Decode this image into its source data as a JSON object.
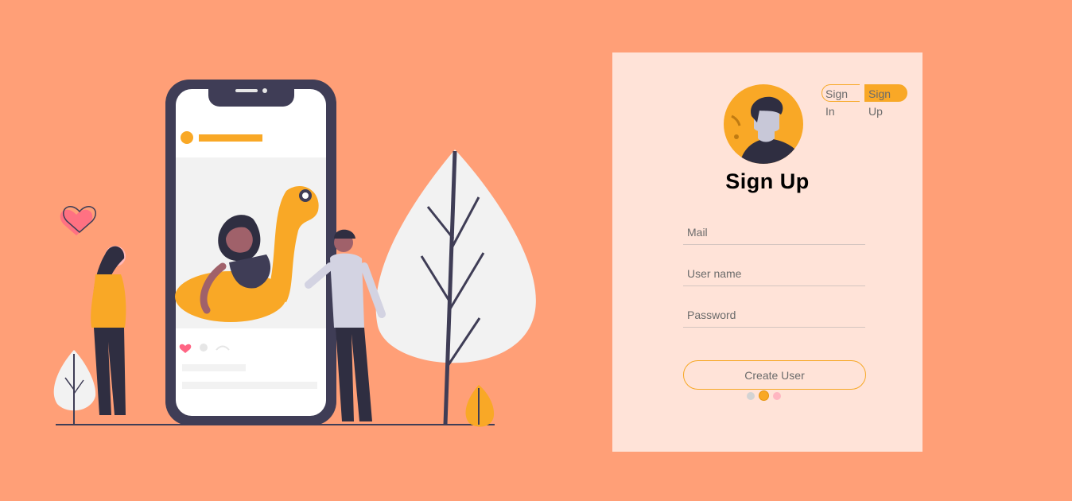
{
  "auth": {
    "sign_in_label": "Sign In",
    "sign_up_label": "Sign Up",
    "title": "Sign Up",
    "fields": {
      "mail_placeholder": "Mail",
      "username_placeholder": "User name",
      "password_placeholder": "Password"
    },
    "submit_label": "Create User",
    "accent_color": "#f9a826",
    "page_dots": [
      {
        "color": "#d3d3d3",
        "active": false
      },
      {
        "color": "#f9a826",
        "active": true
      },
      {
        "color": "#ffb6c1",
        "active": false
      }
    ]
  },
  "colors": {
    "background": "#ff9f77",
    "panel": "#ffe3d8",
    "dark": "#3f3d56"
  },
  "illustration": {
    "description_icons": [
      "heart-icon",
      "phone-icon",
      "leaf-tree-icon"
    ]
  }
}
